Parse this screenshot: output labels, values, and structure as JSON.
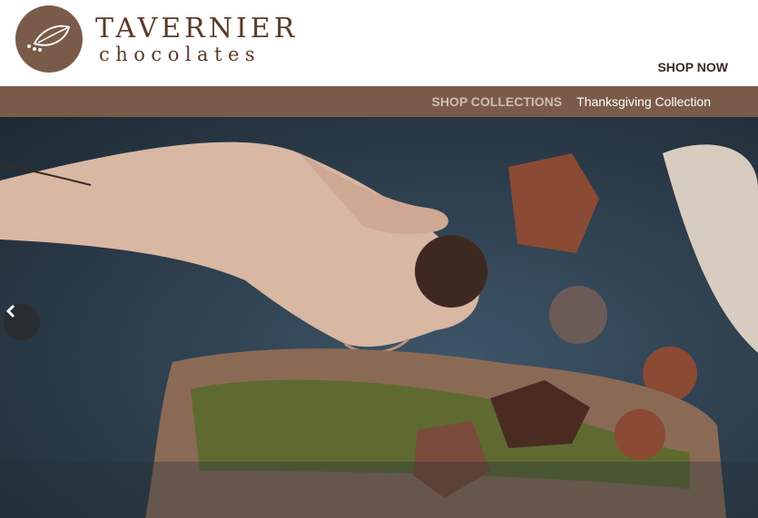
{
  "header": {
    "brand_name": "TAVERNIER",
    "brand_sub": "chocolates",
    "shop_now_label": "SHOP NOW"
  },
  "nav": {
    "items": [
      {
        "label": "SHOP COLLECTIONS"
      },
      {
        "label": "Thanksgiving Collection"
      }
    ]
  },
  "hero": {
    "image": "hand-holding-chocolate-truffle-on-bark-with-moss-and-mushrooms",
    "prev_icon": "chevron-left-icon"
  },
  "colors": {
    "brand_brown": "#7a5b49",
    "nav_text_muted": "#cdbdaf",
    "text_dark": "#3a2a24"
  }
}
